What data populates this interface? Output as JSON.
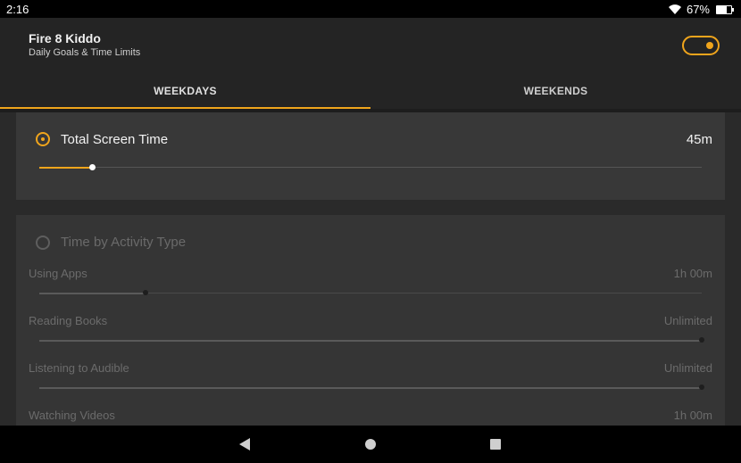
{
  "status_bar": {
    "time": "2:16",
    "battery": "67%",
    "battery_level": 0.67
  },
  "header": {
    "device_name": "Fire 8 Kiddo",
    "subtitle": "Daily Goals & Time Limits",
    "toggle_on": true
  },
  "tabs": [
    {
      "label": "WEEKDAYS",
      "active": true
    },
    {
      "label": "WEEKENDS",
      "active": false
    }
  ],
  "total_screen_time": {
    "label": "Total Screen Time",
    "value": "45m",
    "selected": true,
    "slider_fraction": 0.08
  },
  "activity": {
    "label": "Time by Activity Type",
    "selected": false,
    "items": [
      {
        "label": "Using Apps",
        "value": "1h 00m",
        "slider_fraction": 0.16
      },
      {
        "label": "Reading Books",
        "value": "Unlimited",
        "slider_fraction": 1.0
      },
      {
        "label": "Listening to Audible",
        "value": "Unlimited",
        "slider_fraction": 1.0
      },
      {
        "label": "Watching Videos",
        "value": "1h 00m",
        "slider_fraction": 0.16
      }
    ]
  },
  "colors": {
    "accent": "#f0a51c",
    "background": "#242424",
    "card": "#383838"
  },
  "icons": [
    "wifi-icon",
    "battery-icon",
    "back-icon",
    "home-icon",
    "recents-icon"
  ]
}
